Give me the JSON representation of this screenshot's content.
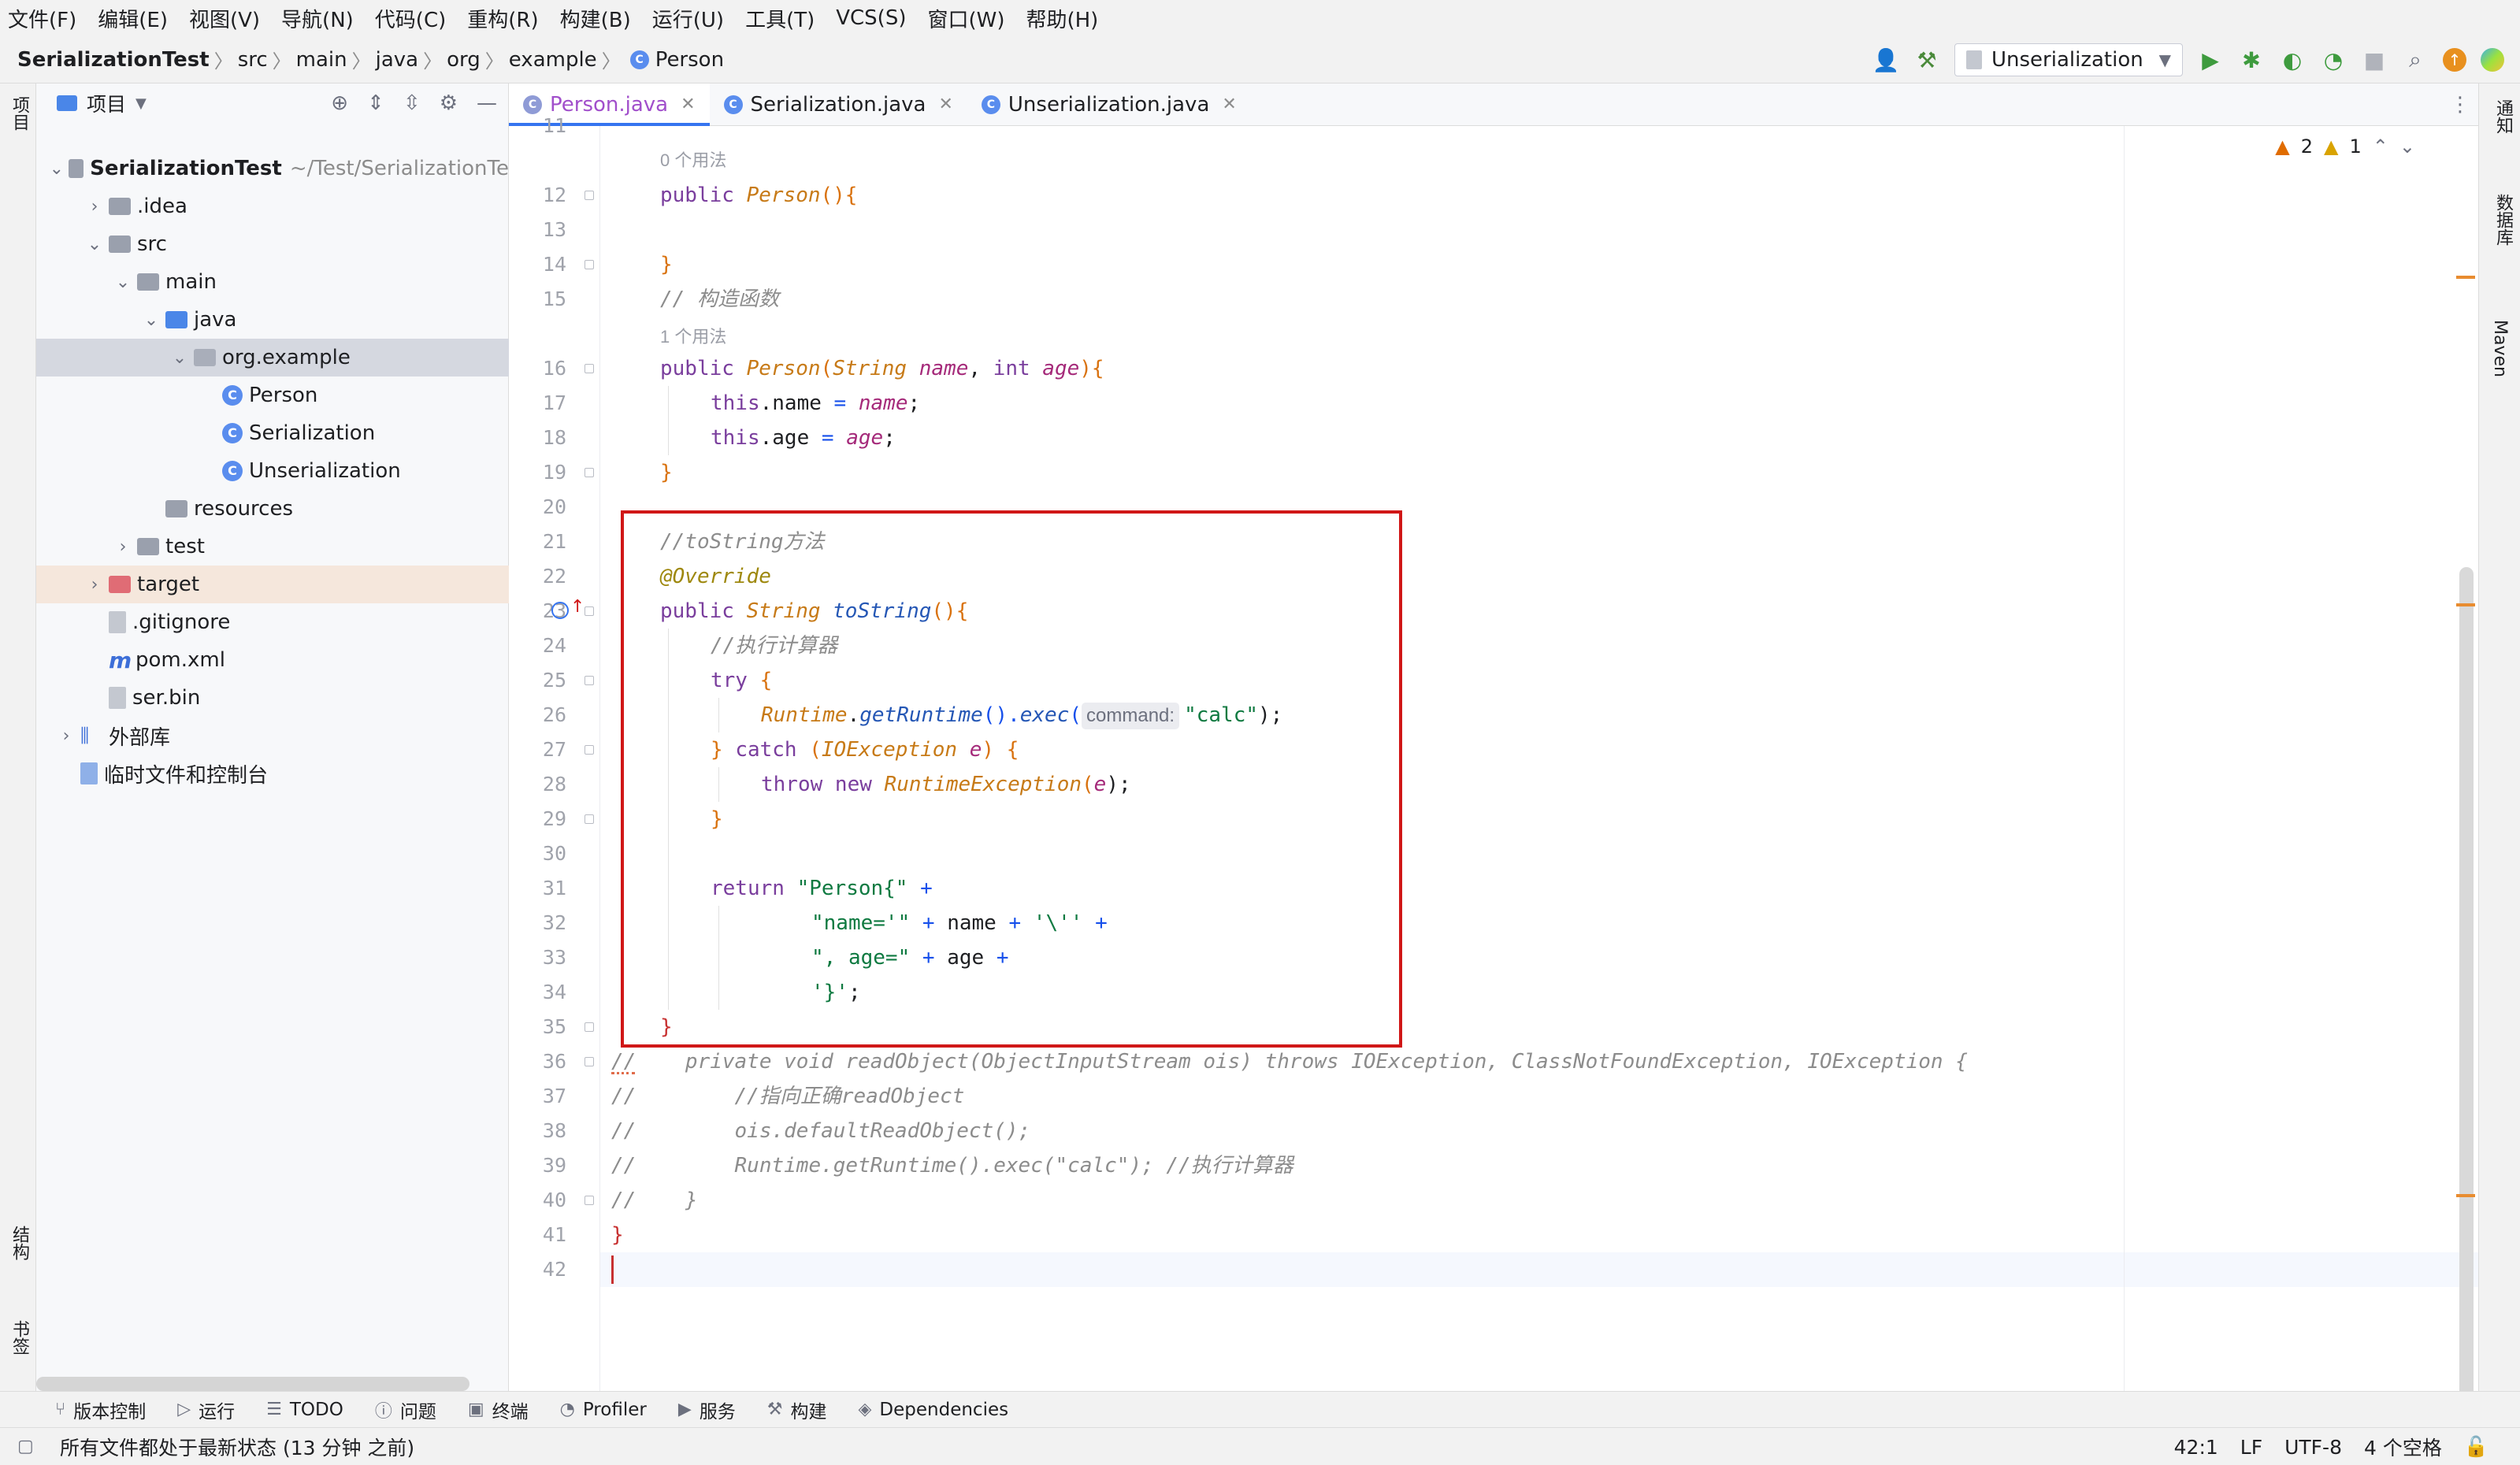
{
  "menu": [
    "文件(F)",
    "编辑(E)",
    "视图(V)",
    "导航(N)",
    "代码(C)",
    "重构(R)",
    "构建(B)",
    "运行(U)",
    "工具(T)",
    "VCS(S)",
    "窗口(W)",
    "帮助(H)"
  ],
  "breadcrumb": [
    "SerializationTest",
    "src",
    "main",
    "java",
    "org",
    "example",
    "Person"
  ],
  "run_config": "Unserialization",
  "left_strip": {
    "project": "项目",
    "structure": "结构",
    "bookmarks": "书签"
  },
  "right_strip": {
    "notifications": "通知",
    "database": "数据库",
    "maven": "Maven"
  },
  "project_panel": {
    "title": "项目",
    "tree": [
      {
        "label": "SerializationTest",
        "extra": "~/Test/SerializationTe",
        "depth": 0,
        "expanded": true,
        "icon": "module-icon"
      },
      {
        "label": ".idea",
        "depth": 1,
        "expanded": false,
        "icon": "folder-icon"
      },
      {
        "label": "src",
        "depth": 1,
        "expanded": true,
        "icon": "folder-icon"
      },
      {
        "label": "main",
        "depth": 2,
        "expanded": true,
        "icon": "folder-icon"
      },
      {
        "label": "java",
        "depth": 3,
        "expanded": true,
        "icon": "source-folder-icon"
      },
      {
        "label": "org.example",
        "depth": 4,
        "expanded": true,
        "icon": "package-icon",
        "selected": true
      },
      {
        "label": "Person",
        "depth": 5,
        "icon": "class-icon"
      },
      {
        "label": "Serialization",
        "depth": 5,
        "icon": "class-icon"
      },
      {
        "label": "Unserialization",
        "depth": 5,
        "icon": "class-icon"
      },
      {
        "label": "resources",
        "depth": 3,
        "icon": "resources-folder-icon"
      },
      {
        "label": "test",
        "depth": 2,
        "expanded": false,
        "icon": "folder-icon"
      },
      {
        "label": "target",
        "depth": 1,
        "expanded": false,
        "icon": "excluded-folder-icon"
      },
      {
        "label": ".gitignore",
        "depth": 1,
        "icon": "file-icon"
      },
      {
        "label": "pom.xml",
        "depth": 1,
        "icon": "maven-icon"
      },
      {
        "label": "ser.bin",
        "depth": 1,
        "icon": "file-icon"
      },
      {
        "label": "外部库",
        "depth": 0,
        "expanded": false,
        "icon": "library-icon"
      },
      {
        "label": "临时文件和控制台",
        "depth": 0,
        "icon": "scratch-icon"
      }
    ]
  },
  "tabs": [
    {
      "label": "Person.java",
      "active": true
    },
    {
      "label": "Serialization.java",
      "active": false
    },
    {
      "label": "Unserialization.java",
      "active": false
    }
  ],
  "inspections": {
    "errors": "2",
    "warnings": "1"
  },
  "code": {
    "hint_usage_0": "0 个用法",
    "hint_usage_1": "1 个用法",
    "param_hint": "command:",
    "lines": [
      {
        "n": "11",
        "text": ""
      },
      {
        "n": "12",
        "text": "public Person(){"
      },
      {
        "n": "13",
        "text": ""
      },
      {
        "n": "14",
        "text": "}"
      },
      {
        "n": "15",
        "text": "// 构造函数"
      },
      {
        "n": "16",
        "text": "public Person(String name, int age){"
      },
      {
        "n": "17",
        "text": "this.name = name;"
      },
      {
        "n": "18",
        "text": "this.age = age;"
      },
      {
        "n": "19",
        "text": "}"
      },
      {
        "n": "20",
        "text": ""
      },
      {
        "n": "21",
        "text": "//toString方法"
      },
      {
        "n": "22",
        "text": "@Override"
      },
      {
        "n": "23",
        "text": "public String toString(){"
      },
      {
        "n": "24",
        "text": "//执行计算器"
      },
      {
        "n": "25",
        "text": "try {"
      },
      {
        "n": "26",
        "text": "Runtime.getRuntime().exec(\"calc\");"
      },
      {
        "n": "27",
        "text": "} catch (IOException e) {"
      },
      {
        "n": "28",
        "text": "throw new RuntimeException(e);"
      },
      {
        "n": "29",
        "text": "}"
      },
      {
        "n": "30",
        "text": ""
      },
      {
        "n": "31",
        "text": "return \"Person{\" +"
      },
      {
        "n": "32",
        "text": "\"name='\" + name + '\\'' +"
      },
      {
        "n": "33",
        "text": "\", age=\" + age +"
      },
      {
        "n": "34",
        "text": "'}';"
      },
      {
        "n": "35",
        "text": "}"
      },
      {
        "n": "36",
        "text": "//    private void readObject(ObjectInputStream ois) throws IOException, ClassNotFoundException, IOException {"
      },
      {
        "n": "37",
        "text": "//        //指向正确readObject"
      },
      {
        "n": "38",
        "text": "//        ois.defaultReadObject();"
      },
      {
        "n": "39",
        "text": "//        Runtime.getRuntime().exec(\"calc\"); //执行计算器"
      },
      {
        "n": "40",
        "text": "//    }"
      },
      {
        "n": "41",
        "text": "}"
      },
      {
        "n": "42",
        "text": ""
      }
    ]
  },
  "tool_windows": [
    "版本控制",
    "运行",
    "TODO",
    "问题",
    "终端",
    "Profiler",
    "服务",
    "构建",
    "Dependencies"
  ],
  "status": {
    "message": "所有文件都处于最新状态 (13 分钟 之前)",
    "position": "42:1",
    "line_sep": "LF",
    "encoding": "UTF-8",
    "indent": "4 个空格"
  },
  "colors": {
    "accent": "#3574f0",
    "highlight_box": "#d01717"
  }
}
